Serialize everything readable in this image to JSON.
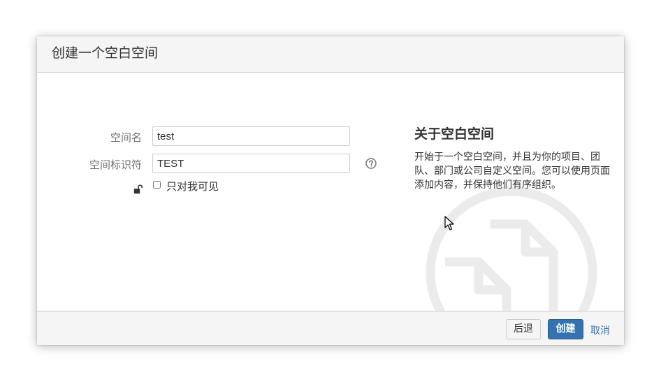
{
  "dialog": {
    "title": "创建一个空白空间"
  },
  "form": {
    "space_name_label": "空间名",
    "space_name_value": "test",
    "space_key_label": "空间标识符",
    "space_key_value": "TEST",
    "private_checkbox_label": "只对我可见",
    "private_checked": false
  },
  "about": {
    "title": "关于空白空间",
    "description": "开始于一个空白空间，并且为你的项目、团队、部门或公司自定义空间。您可以使用页面添加内容，并保持他们有序组织。"
  },
  "footer": {
    "back_label": "后退",
    "create_label": "创建",
    "cancel_label": "取消"
  },
  "colors": {
    "primary": "#3572b0",
    "header_bg": "#f5f5f5",
    "border": "#cccccc",
    "illustration": "#ebebeb"
  },
  "icons": {
    "help": "help-icon",
    "lock": "unlock-icon",
    "illustration": "page-illustration",
    "cursor": "mouse-pointer-icon"
  }
}
